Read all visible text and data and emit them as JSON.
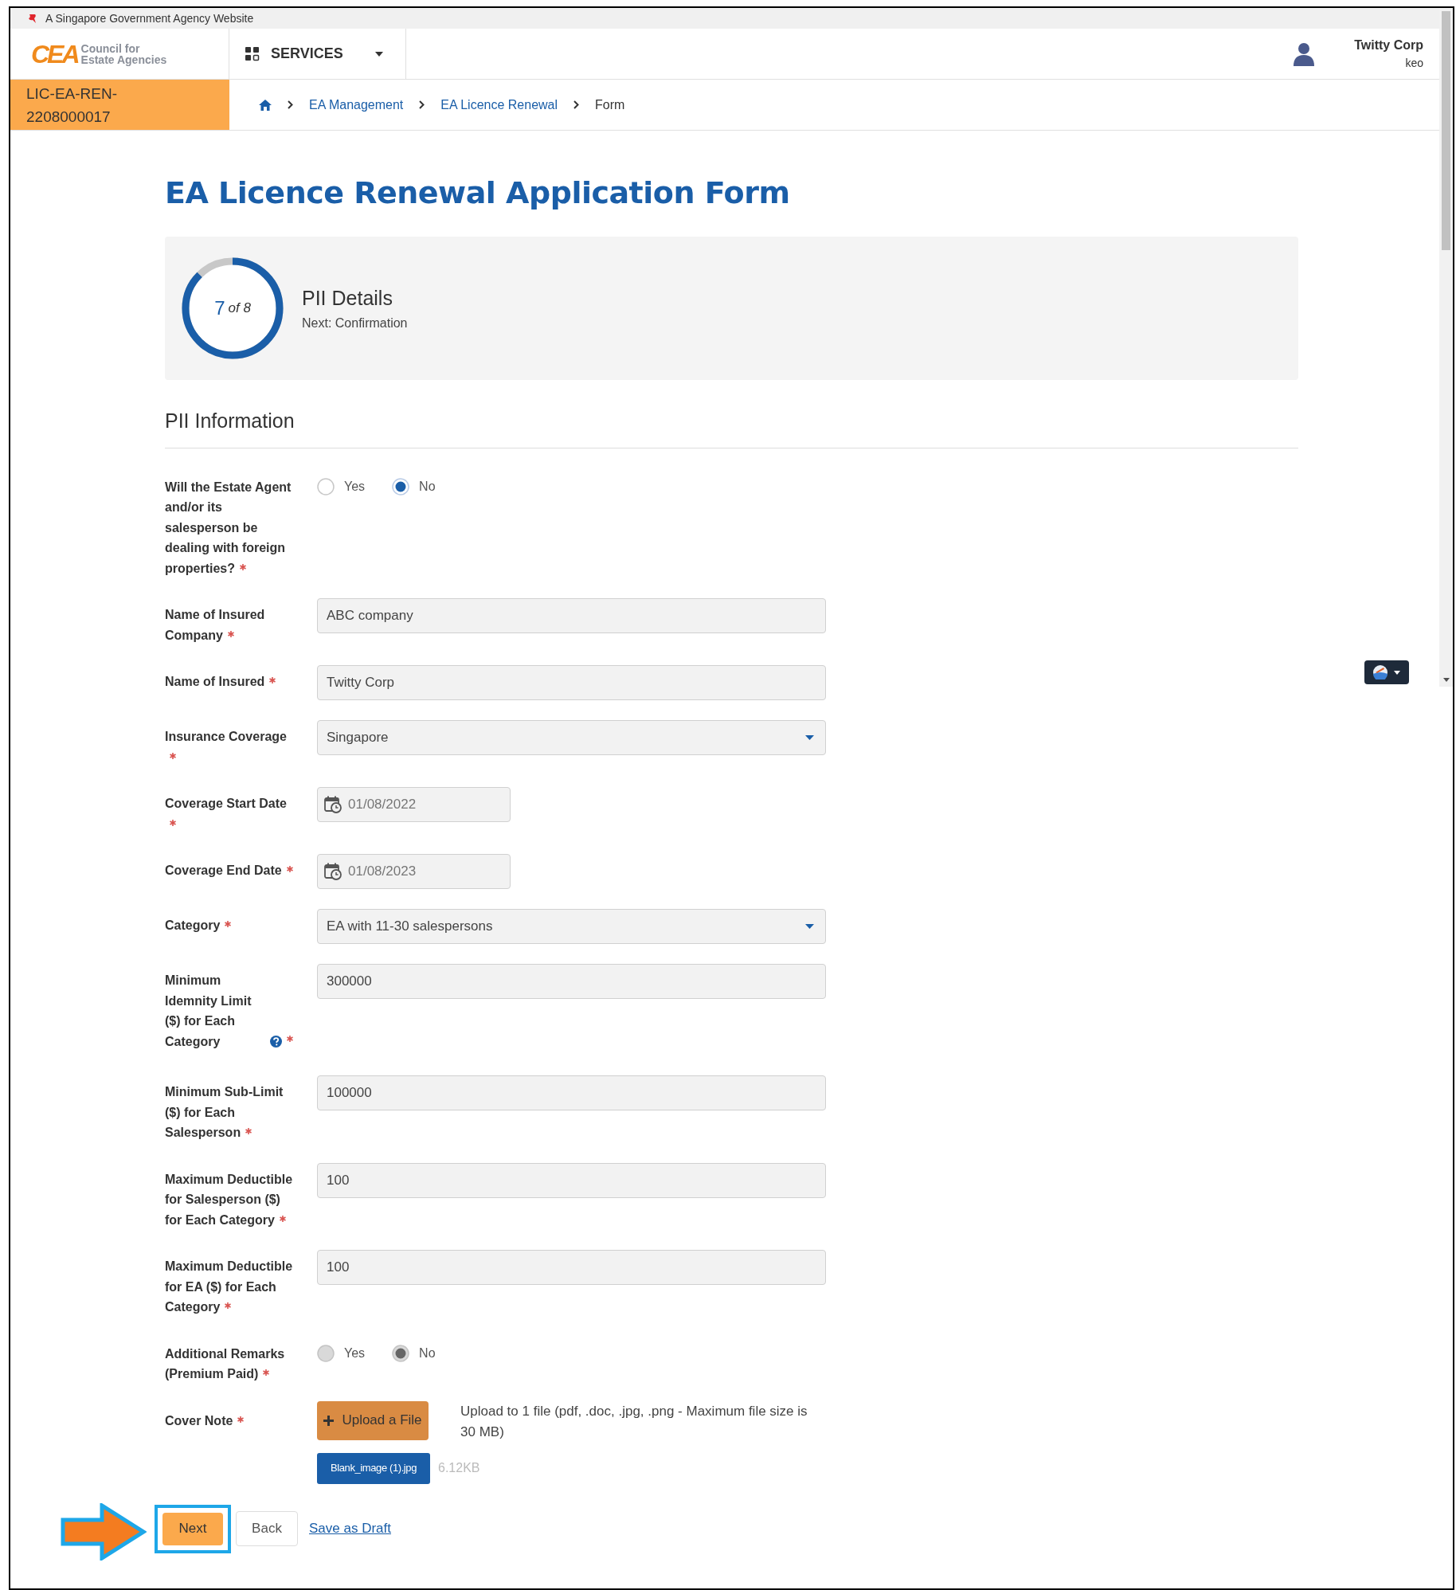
{
  "gov_banner": {
    "text": "A Singapore Government Agency Website"
  },
  "header": {
    "logo": {
      "mark": "CEA",
      "line1": "Council for",
      "line2": "Estate Agencies"
    },
    "services_menu": {
      "label": "SERVICES"
    },
    "user": {
      "name": "Twitty Corp",
      "role": "keo"
    }
  },
  "reference": "LIC-EA-REN-2208000017",
  "breadcrumb": [
    {
      "label": "EA Management",
      "kind": "link"
    },
    {
      "label": "EA Licence Renewal",
      "kind": "link"
    },
    {
      "label": "Form",
      "kind": "current"
    }
  ],
  "title": "EA Licence Renewal Application Form",
  "progress": {
    "step": "7",
    "total": "of 8",
    "level": 0.875,
    "heading": "PII Details",
    "next": "Next: Confirmation"
  },
  "section_title": "PII Information",
  "fields": [
    {
      "kind": "radio",
      "label": "Will the Estate Agent and/or its salesperson be dealing with foreign properties?",
      "required": true,
      "disabled": false,
      "options": [
        {
          "label": "Yes",
          "selected": false
        },
        {
          "label": "No",
          "selected": true
        }
      ]
    },
    {
      "kind": "text",
      "label": "Name of Insured Company",
      "required": true,
      "value": "ABC company"
    },
    {
      "kind": "text",
      "label": "Name of Insured",
      "required": true,
      "value": "Twitty Corp"
    },
    {
      "kind": "select",
      "label": "Insurance Coverage",
      "required": true,
      "value": "Singapore"
    },
    {
      "kind": "date",
      "label": "Coverage Start Date",
      "required": true,
      "value": "01/08/2022"
    },
    {
      "kind": "date",
      "label": "Coverage End Date",
      "required": true,
      "value": "01/08/2023"
    },
    {
      "kind": "select",
      "label": "Category",
      "required": true,
      "value": "EA with 11-30 salespersons"
    },
    {
      "kind": "text",
      "label": "Minimum Idemnity Limit ($) for Each Category",
      "required": true,
      "help": true,
      "value": "300000"
    },
    {
      "kind": "text",
      "label": "Minimum Sub-Limit ($) for Each Salesperson",
      "required": true,
      "value": "100000"
    },
    {
      "kind": "text",
      "label": "Maximum Deductible for Salesperson ($) for Each Category",
      "required": true,
      "value": "100"
    },
    {
      "kind": "text",
      "label": "Maximum Deductible for EA ($) for Each Category",
      "required": true,
      "value": "100"
    },
    {
      "kind": "radio",
      "label": "Additional Remarks (Premium Paid)",
      "required": true,
      "disabled": true,
      "options": [
        {
          "label": "Yes",
          "selected": false
        },
        {
          "label": "No",
          "selected": true
        }
      ]
    },
    {
      "kind": "file",
      "label": "Cover Note",
      "required": true,
      "button": "Upload a File",
      "hint": "Upload to 1 file (pdf, .doc, .jpg, .png - Maximum file size is 30 MB)",
      "file": {
        "name": "Blank_image (1).jpg",
        "size": "6.12KB"
      }
    }
  ],
  "actions": [
    {
      "label": "Next",
      "kind": "primary",
      "highlighted": true
    },
    {
      "label": "Back",
      "kind": "secondary",
      "highlighted": false
    },
    {
      "label": "Save as Draft",
      "kind": "link",
      "highlighted": false
    }
  ]
}
